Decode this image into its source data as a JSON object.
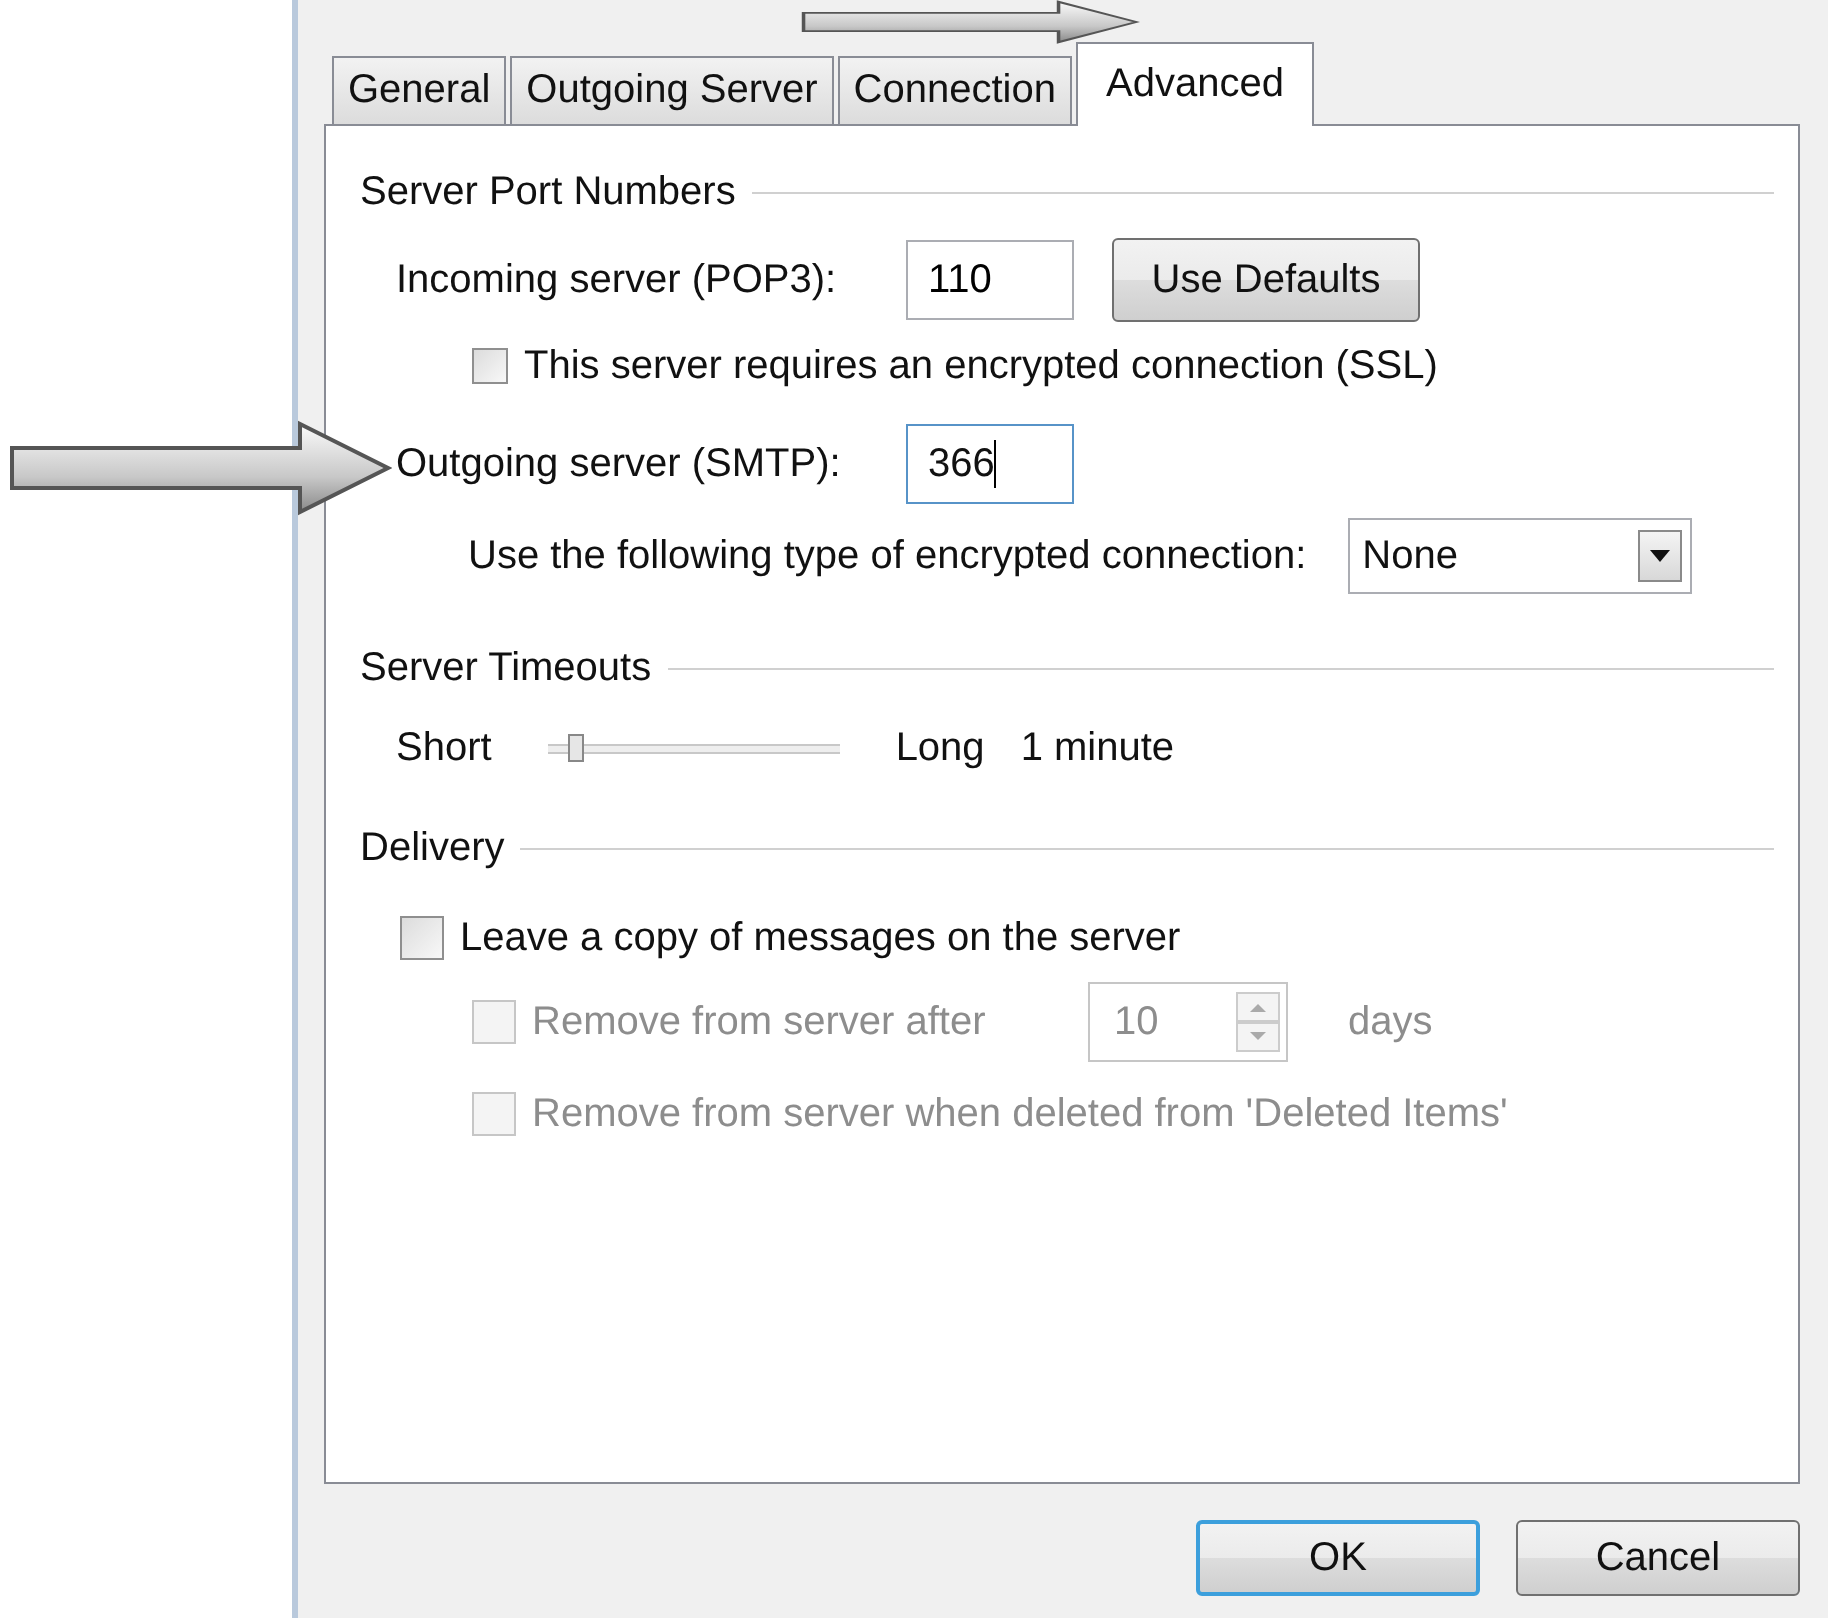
{
  "tabs": [
    {
      "label": "General",
      "selected": false
    },
    {
      "label": "Outgoing Server",
      "selected": false
    },
    {
      "label": "Connection",
      "selected": false
    },
    {
      "label": "Advanced",
      "selected": true
    }
  ],
  "port_numbers": {
    "heading": "Server Port Numbers",
    "incoming_label": "Incoming server (POP3):",
    "incoming_value": "110",
    "defaults_button": "Use Defaults",
    "ssl": {
      "label": "This server requires an encrypted connection (SSL)",
      "checked": false
    },
    "outgoing_label": "Outgoing server (SMTP):",
    "outgoing_value": "366",
    "outgoing_focused": true,
    "encryption_label": "Use the following type of encrypted connection:",
    "encryption_value": "None"
  },
  "timeouts": {
    "heading": "Server Timeouts",
    "short_label": "Short",
    "long_label": "Long",
    "level": 0.07,
    "reading": "1 minute"
  },
  "delivery": {
    "heading": "Delivery",
    "leave_copy": {
      "label": "Leave a copy of messages on the server",
      "checked": false
    },
    "remove_after": {
      "label": "Remove from server after",
      "checked": false,
      "disabled": true,
      "value": "10",
      "unit": "days"
    },
    "remove_deleted": {
      "label": "Remove from server when deleted from 'Deleted Items'",
      "checked": false,
      "disabled": true
    }
  },
  "buttons": [
    {
      "label": "OK",
      "default": true
    },
    {
      "label": "Cancel",
      "default": false
    }
  ]
}
